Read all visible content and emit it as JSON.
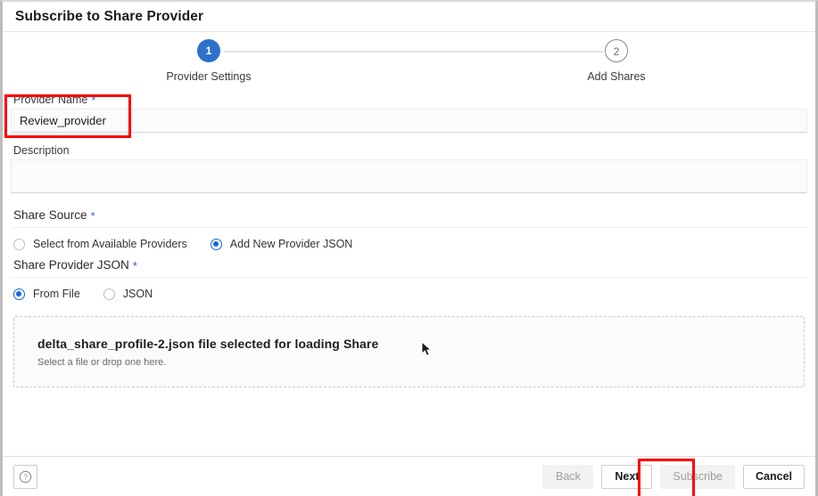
{
  "window": {
    "title": "Subscribe to Share Provider"
  },
  "stepper": {
    "steps": [
      {
        "number": "1",
        "label": "Provider Settings",
        "state": "active"
      },
      {
        "number": "2",
        "label": "Add Shares",
        "state": "inactive"
      }
    ]
  },
  "form": {
    "provider_name": {
      "label": "Provider Name",
      "required_marker": "*",
      "value": "Review_provider",
      "placeholder": ""
    },
    "description": {
      "label": "Description",
      "value": "",
      "placeholder": ""
    },
    "share_source": {
      "label": "Share Source",
      "required_marker": "*",
      "options": [
        {
          "label": "Select from Available Providers",
          "selected": false
        },
        {
          "label": "Add New Provider JSON",
          "selected": true
        }
      ]
    },
    "share_provider_json": {
      "label": "Share Provider JSON",
      "required_marker": "*",
      "options": [
        {
          "label": "From File",
          "selected": true
        },
        {
          "label": "JSON",
          "selected": false
        }
      ]
    },
    "dropzone": {
      "title": "delta_share_profile-2.json file selected for loading Share",
      "hint": "Select a file or drop one here."
    }
  },
  "footer": {
    "help_icon": "question-circle-icon",
    "buttons": [
      {
        "label": "Back",
        "state": "disabled"
      },
      {
        "label": "Next",
        "state": "enabled"
      },
      {
        "label": "Subscribe",
        "state": "disabled"
      },
      {
        "label": "Cancel",
        "state": "enabled"
      }
    ]
  },
  "colors": {
    "accent_blue": "#2d72c9",
    "radio_blue": "#1565d8",
    "annotation_red": "#ff0000"
  }
}
